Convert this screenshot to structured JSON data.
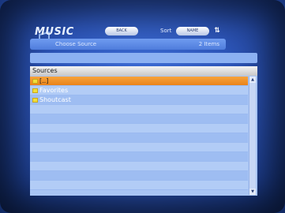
{
  "app": {
    "title": "MUSIC"
  },
  "toolbar": {
    "back_label": "BACK",
    "sort_label": "Sort",
    "sort_value": "NAME",
    "sort_dir_symbol": "⇅"
  },
  "subheader": {
    "label": "Choose Source",
    "count": "2 Items"
  },
  "list": {
    "header": "Sources",
    "items": [
      {
        "label": "[..]",
        "selected": true
      },
      {
        "label": "Favorites",
        "selected": false
      },
      {
        "label": "Shoutcast",
        "selected": false
      },
      {
        "label": "",
        "selected": false
      },
      {
        "label": "",
        "selected": false
      },
      {
        "label": "",
        "selected": false
      },
      {
        "label": "",
        "selected": false
      },
      {
        "label": "",
        "selected": false
      },
      {
        "label": "",
        "selected": false
      },
      {
        "label": "",
        "selected": false
      },
      {
        "label": "",
        "selected": false
      },
      {
        "label": "",
        "selected": false
      }
    ]
  },
  "colors": {
    "background": "#2d55b8",
    "selection": "#f0921f",
    "row": "#a9c5f4"
  },
  "icons": [
    "music-notes-icon",
    "folder-icon",
    "sort-toggle-icon",
    "scroll-up-icon",
    "scroll-down-icon"
  ]
}
